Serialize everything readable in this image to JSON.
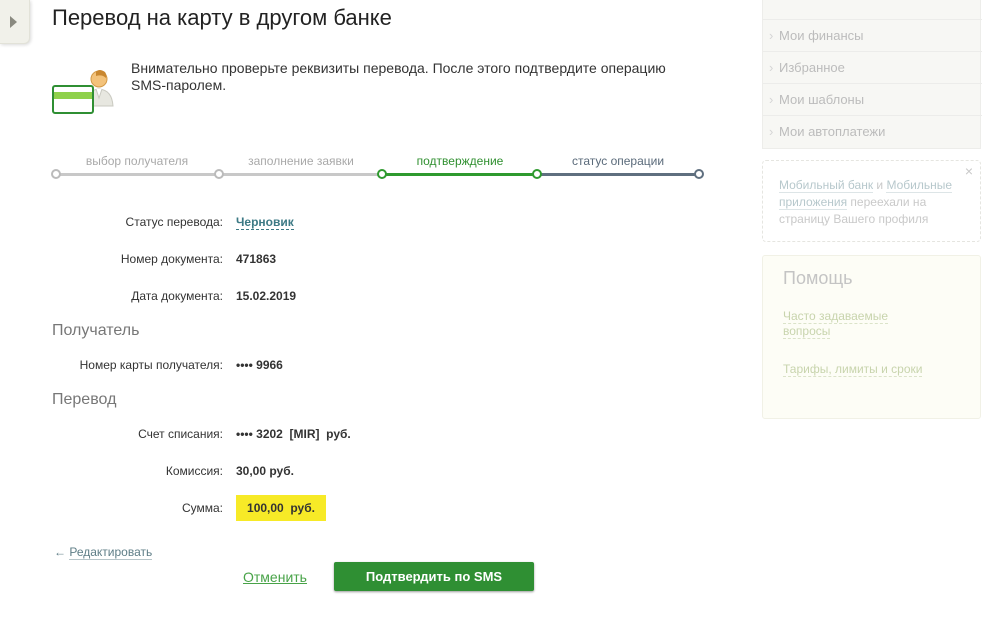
{
  "page": {
    "title": "Перевод на карту в другом банке",
    "intro": "Внимательно проверьте реквизиты перевода. После этого подтвердите операцию SMS-паролем."
  },
  "stepper": {
    "steps": [
      {
        "label": "выбор получателя",
        "state": "done"
      },
      {
        "label": "заполнение заявки",
        "state": "done"
      },
      {
        "label": "подтверждение",
        "state": "active"
      },
      {
        "label": "статус операции",
        "state": "next"
      }
    ]
  },
  "details": {
    "status_label": "Статус перевода:",
    "status_value": "Черновик",
    "doc_number_label": "Номер документа:",
    "doc_number_value": "471863",
    "doc_date_label": "Дата документа:",
    "doc_date_value": "15.02.2019"
  },
  "recipient": {
    "section_title": "Получатель",
    "card_label": "Номер карты получателя:",
    "card_value": "•••• 9966"
  },
  "transfer": {
    "section_title": "Перевод",
    "account_label": "Счет списания:",
    "account_value": "•••• 3202  [MIR]  руб.",
    "fee_label": "Комиссия:",
    "fee_value": "30,00 руб.",
    "amount_label": "Сумма:",
    "amount_value": "100,00  руб."
  },
  "actions": {
    "edit_arrow": "←",
    "edit_label": "Редактировать",
    "cancel_label": "Отменить",
    "confirm_label": "Подтвердить по SMS"
  },
  "sidebar": {
    "menu": [
      "Мои финансы",
      "Избранное",
      "Мои шаблоны",
      "Мои автоплатежи"
    ],
    "notice": {
      "close": "×",
      "link1": "Мобильный банк",
      "and": " и ",
      "link2": "Мобильные приложения",
      "rest": " переехали на страницу Вашего профиля"
    },
    "help": {
      "title": "Помощь",
      "faq": "Часто задаваемые вопросы",
      "tariffs": "Тарифы, лимиты и сроки"
    }
  },
  "colors": {
    "accent_green": "#2f8f33",
    "highlight_yellow": "#f7ea27",
    "step_done": "#bbbbbb",
    "step_active": "#2f9a2f",
    "step_next": "#5f6f7f"
  }
}
